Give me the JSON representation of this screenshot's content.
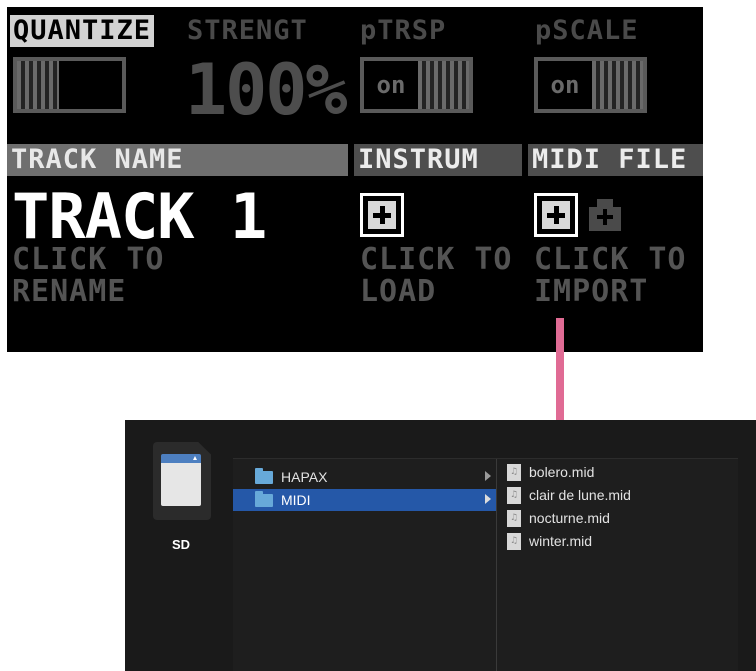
{
  "device": {
    "headers": {
      "quantize": "QUANTIZE",
      "strength": "STRENGT",
      "ptrsp": "pTRSP",
      "pscale": "pSCALE",
      "track_name": "TRACK NAME",
      "instrument": "INSTRUM",
      "midi_file": "MIDI FILE"
    },
    "strength_value": "100%",
    "ptrsp_toggle": "on",
    "pscale_toggle": "on",
    "track_name_value": "TRACK 1",
    "hints": {
      "rename": "CLICK TO\nRENAME",
      "load": "CLICK TO\nLOAD",
      "import": "CLICK TO\nIMPORT"
    }
  },
  "arrow_color": "#e06b94",
  "finder": {
    "drive_label": "SD",
    "folders": [
      {
        "name": "HAPAX",
        "selected": false
      },
      {
        "name": "MIDI",
        "selected": true
      }
    ],
    "files": [
      "bolero.mid",
      "clair de lune.mid",
      "nocturne.mid",
      "winter.mid"
    ],
    "selection_color": "#2558a8"
  }
}
